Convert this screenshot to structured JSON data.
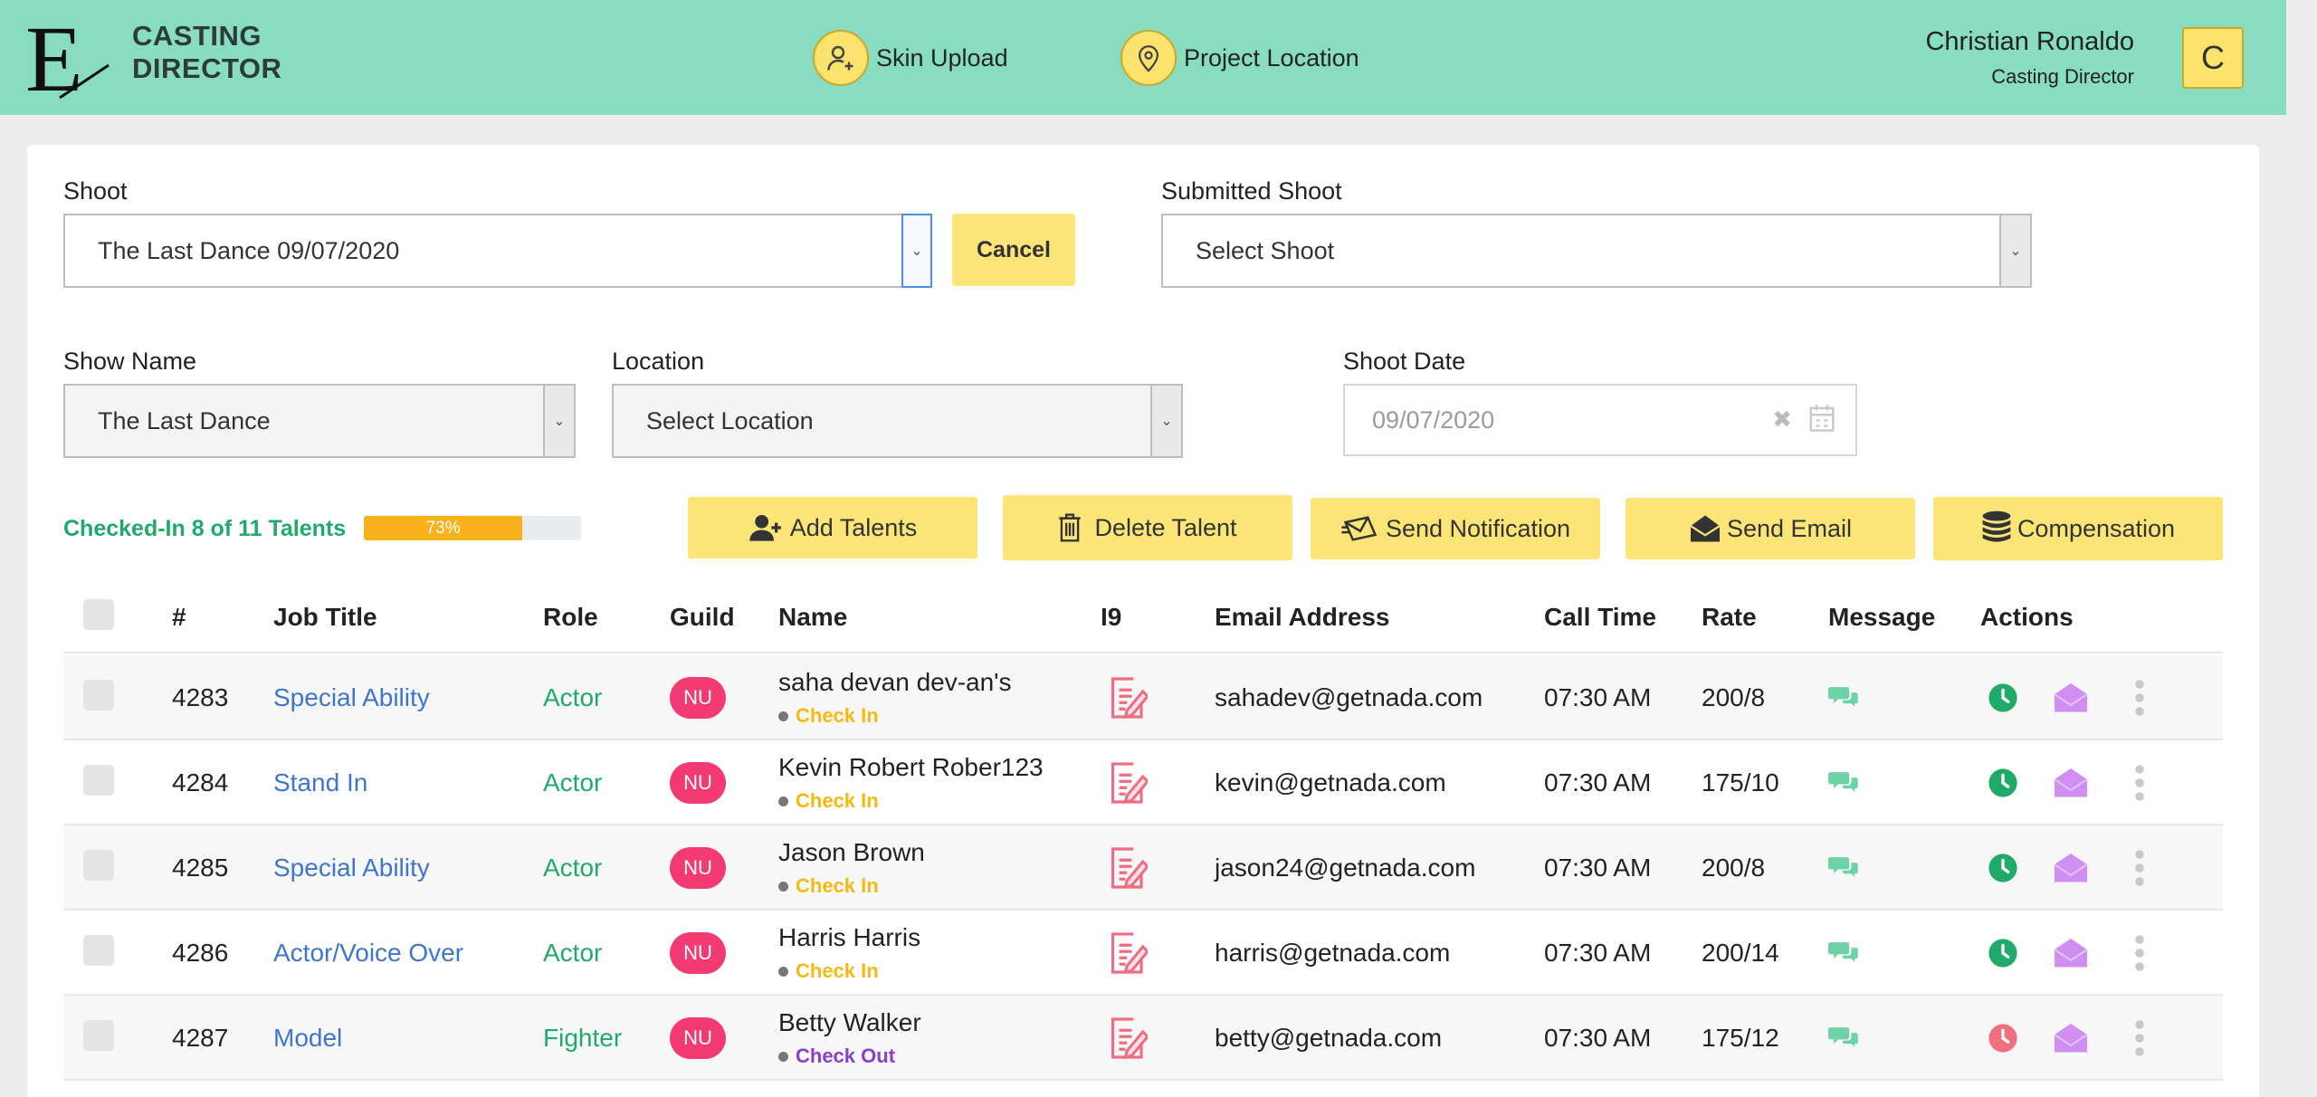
{
  "header": {
    "logo_letter": "E",
    "logo_line1": "CASTING",
    "logo_line2": "DIRECTOR",
    "nav": [
      {
        "label": "Skin Upload",
        "icon": "user-plus-icon"
      },
      {
        "label": "Project Location",
        "icon": "map-pin-icon"
      }
    ],
    "user_name": "Christian Ronaldo",
    "user_role": "Casting Director",
    "avatar_initial": "C"
  },
  "form": {
    "shoot_label": "Shoot",
    "shoot_value": "The Last Dance 09/07/2020",
    "cancel_label": "Cancel",
    "submitted_label": "Submitted Shoot",
    "submitted_value": "Select Shoot",
    "show_label": "Show Name",
    "show_value": "The Last Dance",
    "location_label": "Location",
    "location_value": "Select Location",
    "date_label": "Shoot Date",
    "date_value": "09/07/2020"
  },
  "progress": {
    "checked_in_text": "Checked-In 8 of 11 Talents",
    "percent": 73,
    "percent_label": "73%"
  },
  "actions": {
    "add": "Add Talents",
    "delete": "Delete Talent",
    "notify": "Send Notification",
    "email": "Send Email",
    "compensation": "Compensation"
  },
  "table": {
    "headers": [
      "#",
      "Job Title",
      "Role",
      "Guild",
      "Name",
      "I9",
      "Email Address",
      "Call Time",
      "Rate",
      "Message",
      "Actions"
    ],
    "rows": [
      {
        "id": "4283",
        "job": "Special Ability",
        "role": "Actor",
        "guild": "NU",
        "name": "saha devan dev-an's",
        "status": "Check In",
        "email": "sahadev@getnada.com",
        "call": "07:30 AM",
        "rate": "200/8"
      },
      {
        "id": "4284",
        "job": "Stand In",
        "role": "Actor",
        "guild": "NU",
        "name": "Kevin Robert Rober123",
        "status": "Check In",
        "email": "kevin@getnada.com",
        "call": "07:30 AM",
        "rate": "175/10"
      },
      {
        "id": "4285",
        "job": "Special Ability",
        "role": "Actor",
        "guild": "NU",
        "name": "Jason Brown",
        "status": "Check In",
        "email": "jason24@getnada.com",
        "call": "07:30 AM",
        "rate": "200/8"
      },
      {
        "id": "4286",
        "job": "Actor/Voice Over",
        "role": "Actor",
        "guild": "NU",
        "name": "Harris Harris",
        "status": "Check In",
        "email": "harris@getnada.com",
        "call": "07:30 AM",
        "rate": "200/14"
      },
      {
        "id": "4287",
        "job": "Model",
        "role": "Fighter",
        "guild": "NU",
        "name": "Betty Walker",
        "status": "Check Out",
        "email": "betty@getnada.com",
        "call": "07:30 AM",
        "rate": "175/12"
      }
    ]
  },
  "colors": {
    "header_bg": "#88dcc0",
    "accent_yellow": "#fbe577",
    "check_in": "#f5b914",
    "check_out": "#8a3fc4",
    "guild_badge": "#f33a72",
    "clock_green": "#1faa6a",
    "clock_red": "#f0707f"
  }
}
